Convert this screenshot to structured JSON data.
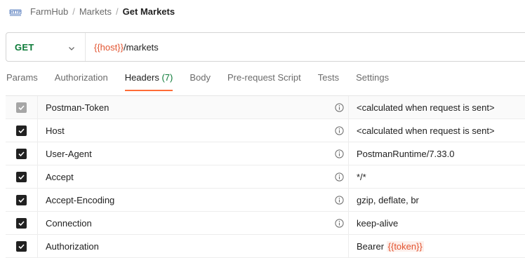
{
  "breadcrumb": {
    "icon": "http-icon",
    "workspace": "FarmHub",
    "collection": "Markets",
    "separator": "/",
    "request": "Get Markets"
  },
  "request": {
    "method": "GET",
    "url_variable": "{{host}}",
    "url_path": "/markets"
  },
  "tabs": [
    {
      "label": "Params"
    },
    {
      "label": "Authorization"
    },
    {
      "label": "Headers",
      "count": "(7)",
      "active": true
    },
    {
      "label": "Body"
    },
    {
      "label": "Pre-request Script"
    },
    {
      "label": "Tests"
    },
    {
      "label": "Settings"
    }
  ],
  "headers": [
    {
      "key": "Postman-Token",
      "value": "<calculated when request is sent>",
      "checked": true,
      "disabled": true,
      "info": true
    },
    {
      "key": "Host",
      "value": "<calculated when request is sent>",
      "checked": true,
      "info": true
    },
    {
      "key": "User-Agent",
      "value": "PostmanRuntime/7.33.0",
      "checked": true,
      "info": true
    },
    {
      "key": "Accept",
      "value": "*/*",
      "checked": true,
      "info": true
    },
    {
      "key": "Accept-Encoding",
      "value": "gzip, deflate, br",
      "checked": true,
      "info": true
    },
    {
      "key": "Connection",
      "value": "keep-alive",
      "checked": true,
      "info": true
    },
    {
      "key": "Authorization",
      "value_prefix": "Bearer ",
      "value_variable": "{{token}}",
      "checked": true,
      "info": false
    }
  ],
  "colors": {
    "accent": "#ff6c37",
    "method_get": "#0b7a37",
    "variable": "#e2532f"
  }
}
